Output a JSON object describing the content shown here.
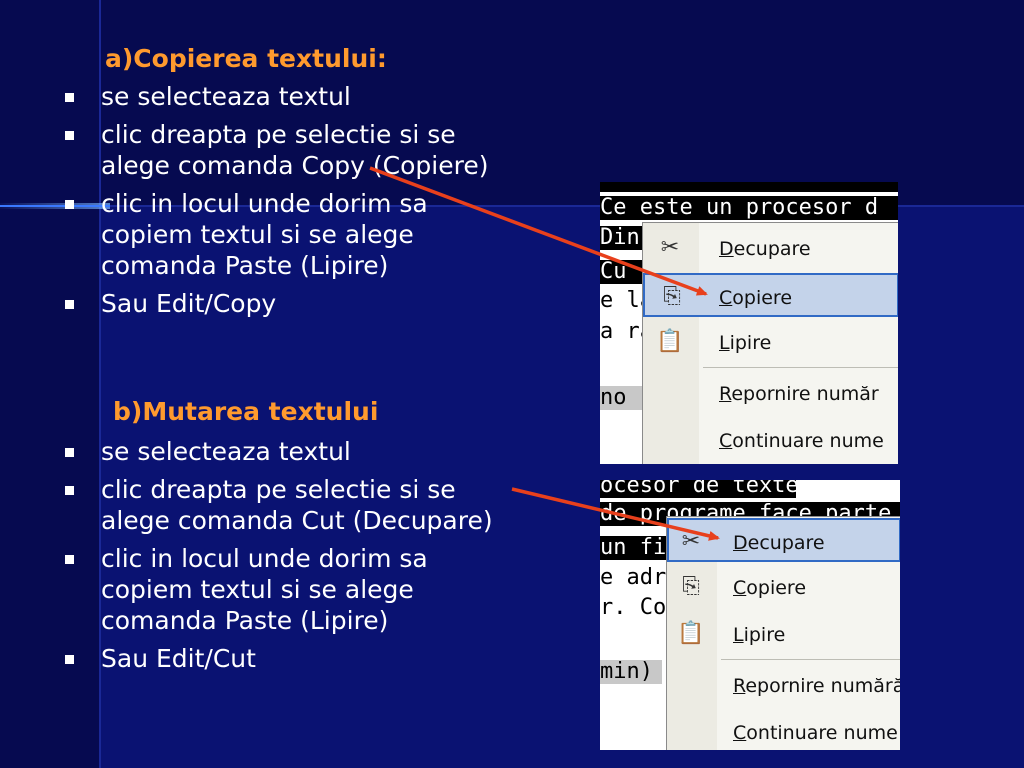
{
  "section_a": {
    "heading": "a)Copierea textului:",
    "bullets": [
      "se selecteaza textul",
      "clic dreapta pe selectie si se alege comanda Copy (Copiere)",
      "clic in locul unde dorim sa copiem textul si se alege comanda Paste (Lipire)",
      "Sau Edit/Copy"
    ]
  },
  "section_b": {
    "heading": "b)Mutarea textului",
    "bullets": [
      "se selecteaza textul",
      "clic dreapta pe selectie si se alege comanda Cut (Decupare)",
      "clic in locul unde dorim sa copiem textul si se alege comanda Paste (Lipire)",
      "Sau Edit/Cut"
    ]
  },
  "screenshot_copy": {
    "doc_lines": [
      "Ce este un procesor d",
      "Din",
      "Cu",
      "e la",
      "a ra",
      "no"
    ],
    "menu": [
      {
        "label": "Decupare",
        "accel": "D",
        "rest": "ecupare",
        "icon": "scissors-icon",
        "highlighted": false
      },
      {
        "label": "Copiere",
        "accel": "C",
        "rest": "opiere",
        "icon": "copy-icon",
        "highlighted": true
      },
      {
        "label": "Lipire",
        "accel": "L",
        "rest": "ipire",
        "icon": "paste-icon",
        "highlighted": false
      },
      {
        "label": "Repornire număr",
        "accel": "R",
        "rest": "epornire număr",
        "icon": "",
        "highlighted": false
      },
      {
        "label": "Continuare nume",
        "accel": "C",
        "rest": "ontinuare nume",
        "icon": "",
        "highlighted": false
      }
    ]
  },
  "screenshot_cut": {
    "doc_lines": [
      "ocesor de texte",
      "de programe face parte",
      "un fi",
      "e adre",
      "r. Cor",
      "min)"
    ],
    "menu": [
      {
        "label": "Decupare",
        "accel": "D",
        "rest": "ecupare",
        "icon": "scissors-icon",
        "highlighted": true
      },
      {
        "label": "Copiere",
        "accel": "C",
        "rest": "opiere",
        "icon": "copy-icon",
        "highlighted": false
      },
      {
        "label": "Lipire",
        "accel": "L",
        "rest": "ipire",
        "icon": "paste-icon",
        "highlighted": false
      },
      {
        "label": "Repornire numără",
        "accel": "R",
        "rest": "epornire numără",
        "icon": "",
        "highlighted": false
      },
      {
        "label": "Continuare nume",
        "accel": "C",
        "rest": "ontinuare nume",
        "icon": "",
        "highlighted": false
      }
    ]
  },
  "colors": {
    "background": "#0a0f6e",
    "heading": "#ff9a2e",
    "text": "#ffffff",
    "arrow": "#e8401c",
    "menu_highlight": "#c4d3ea"
  }
}
